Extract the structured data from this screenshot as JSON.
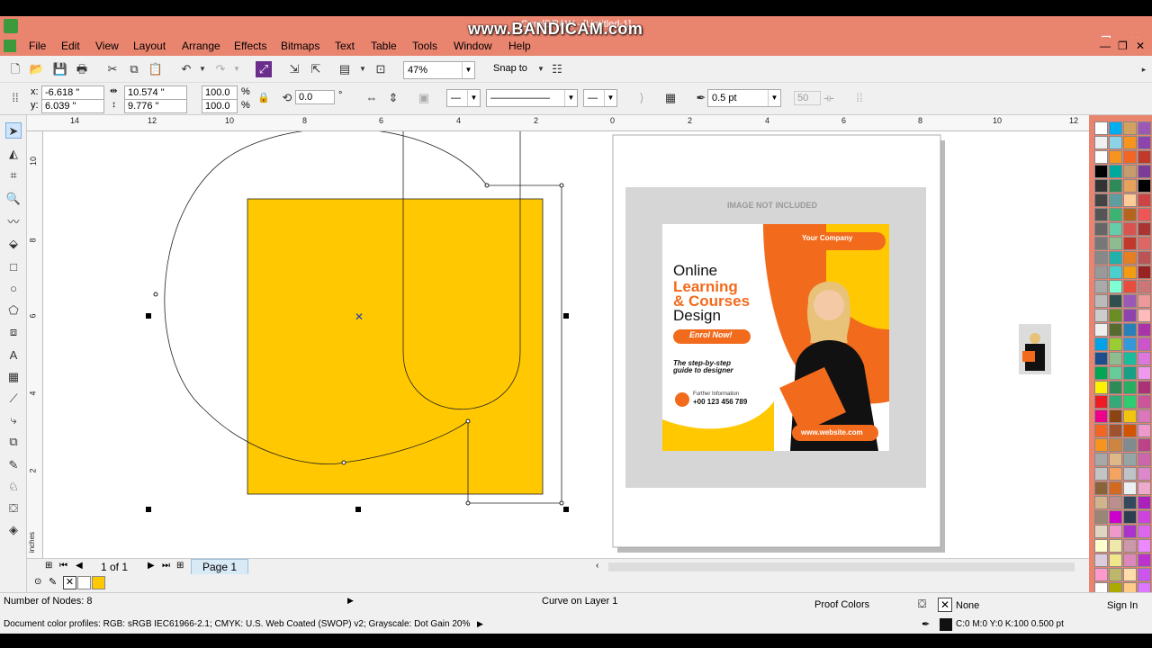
{
  "window": {
    "title": "CorelDRAW - [Untitled-1]",
    "watermark": "www.BANDICAM.com",
    "controls": {
      "minimize": "—",
      "maximize": "❐",
      "close": "✕"
    }
  },
  "menu": {
    "items": [
      "File",
      "Edit",
      "View",
      "Layout",
      "Arrange",
      "Effects",
      "Bitmaps",
      "Text",
      "Table",
      "Tools",
      "Window",
      "Help"
    ]
  },
  "toolbar": {
    "zoom": "47%",
    "snap_to": "Snap to"
  },
  "property_bar": {
    "x": "-6.618 \"",
    "y": "6.039 \"",
    "x_label": "x:",
    "y_label": "y:",
    "width": "10.574 \"",
    "height": "9.776 \"",
    "scale_w": "100.0",
    "scale_h": "100.0",
    "pct": "%",
    "rotation": "0.0",
    "deg": "°",
    "outline_width": "0.5 pt",
    "smoothing": "50"
  },
  "rulers": {
    "h_ticks": [
      "14",
      "12",
      "10",
      "8",
      "6",
      "4",
      "2",
      "0",
      "2",
      "4",
      "6",
      "8",
      "10",
      "12"
    ],
    "v_ticks": [
      "10",
      "8",
      "6",
      "4",
      "2"
    ],
    "unit": "inches"
  },
  "page_nav": {
    "page_count": "1 of 1",
    "page_tab": "Page 1"
  },
  "poster": {
    "image_note": "IMAGE NOT INCLUDED",
    "company": "Your Company",
    "headline_1": "Online",
    "headline_2": "Learning",
    "headline_3": "& Courses",
    "headline_4": "Design",
    "cta": "Enrol Now!",
    "tagline_1": "The step-by-step",
    "tagline_2": "guide to designer",
    "info_label": "Further Information",
    "phone": "+00 123 456 789",
    "website": "www.website.com"
  },
  "status": {
    "nodes": "Number of Nodes: 8",
    "object": "Curve on Layer 1",
    "proof_colors": "Proof Colors",
    "fill": "None",
    "sign_in": "Sign In",
    "color_profiles": "Document color profiles: RGB: sRGB IEC61966-2.1; CMYK: U.S. Web Coated (SWOP) v2; Grayscale: Dot Gain 20%",
    "outline_info": "C:0 M:0 Y:0 K:100  0.500 pt"
  },
  "colors": {
    "titlebar": "#e9846f",
    "yellow": "#ffc800",
    "orange": "#f26b1d"
  }
}
